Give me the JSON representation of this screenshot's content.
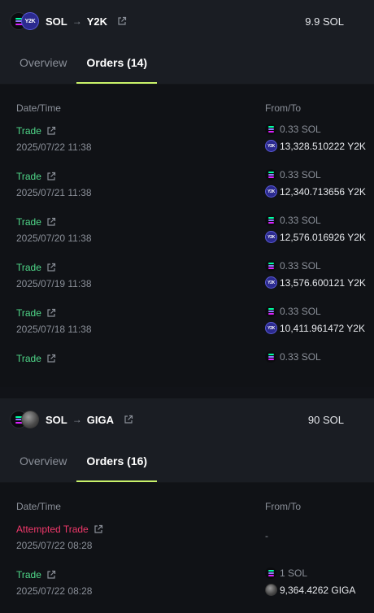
{
  "cards": [
    {
      "from_token": "SOL",
      "to_token": "Y2K",
      "arrow": "→",
      "amount": "9.9 SOL",
      "tabs": [
        "Overview",
        "Orders (14)"
      ],
      "active_tab": 1,
      "columns": [
        "Date/Time",
        "From/To"
      ],
      "rows": [
        {
          "status": "Trade",
          "date": "2025/07/22 11:38",
          "from": "0.33 SOL",
          "to": "13,328.510222 Y2K"
        },
        {
          "status": "Trade",
          "date": "2025/07/21 11:38",
          "from": "0.33 SOL",
          "to": "12,340.713656 Y2K"
        },
        {
          "status": "Trade",
          "date": "2025/07/20 11:38",
          "from": "0.33 SOL",
          "to": "12,576.016926 Y2K"
        },
        {
          "status": "Trade",
          "date": "2025/07/19 11:38",
          "from": "0.33 SOL",
          "to": "13,576.600121 Y2K"
        },
        {
          "status": "Trade",
          "date": "2025/07/18 11:38",
          "from": "0.33 SOL",
          "to": "10,411.961472 Y2K"
        },
        {
          "status": "Trade",
          "date": "",
          "from": "0.33 SOL",
          "to": ""
        }
      ]
    },
    {
      "from_token": "SOL",
      "to_token": "GIGA",
      "arrow": "→",
      "amount": "90 SOL",
      "tabs": [
        "Overview",
        "Orders (16)"
      ],
      "active_tab": 1,
      "columns": [
        "Date/Time",
        "From/To"
      ],
      "rows": [
        {
          "status": "Attempted Trade",
          "date": "2025/07/22 08:28",
          "dash": "-"
        },
        {
          "status": "Trade",
          "date": "2025/07/22 08:28",
          "from": "1 SOL",
          "to": "9,364.4262 GIGA"
        }
      ]
    }
  ],
  "token_badge_y2k": "Y2K",
  "colors": {
    "accent": "#c9f26a",
    "trade": "#4fd889",
    "attempted": "#f0386a"
  },
  "icons": [
    "solana-icon",
    "y2k-token-icon",
    "giga-token-icon",
    "external-link-icon"
  ]
}
